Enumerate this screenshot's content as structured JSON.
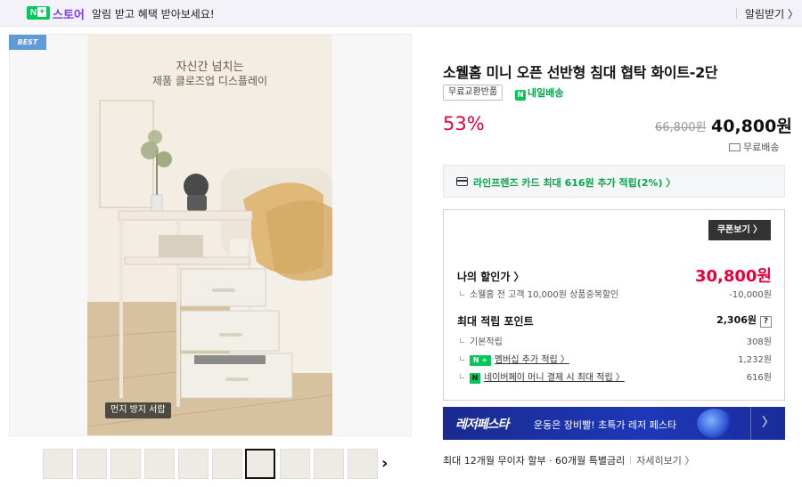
{
  "banner": {
    "nplus_icon": "nplus-logo",
    "store": "스토어",
    "message": "알림 받고 혜택 받아보세요!",
    "notify_label": "알림받기 〉"
  },
  "gallery": {
    "best_badge": "BEST",
    "caption_line1": "자신간 넘치는",
    "caption_line2": "제품 클로즈업 디스플레이",
    "dust_tag": "먼지 방지 서랍",
    "thumbnail_count": 10,
    "active_thumbnail_index": 6,
    "next_icon": "chevron-right-icon"
  },
  "product": {
    "title": "소웰홈 미니 오픈 선반형 침대 협탁 화이트-2단",
    "tag_return": "무료교환반품",
    "tag_delivery": "내일배송",
    "discount": "53%",
    "original_price": "66,800원",
    "price": "40,800원",
    "shipping": "무료배송"
  },
  "card_benefit": {
    "text": "라인프렌즈 카드 최대 616원 추가 적립(2%) 〉"
  },
  "benefit_box": {
    "coupon_button": "쿠폰보기 〉",
    "my_discount_label": "나의 할인가 〉",
    "my_discount_value": "30,800원",
    "coupon_detail": "소웰홈 전 고객 10,000원 상품중복할인",
    "coupon_detail_value": "-10,000원",
    "points_label": "최대 적립 포인트",
    "points_value": "2,306원",
    "help_icon": "?",
    "base_label": "기본적립",
    "base_value": "308원",
    "membership_label": "멤버십 추가 적립 〉",
    "membership_value": "1,232원",
    "npay_label": "네이버페이 머니 결제 시 최대 적립 〉",
    "npay_value": "616원"
  },
  "ad": {
    "brand": "레저페스타",
    "text": "운동은 장비빨! 초특가 레저 페스타",
    "arrow": "〉"
  },
  "installment": {
    "text": "최대 12개월 무이자 할부 · 60개월 특별금리",
    "detail": "자세히보기 〉"
  },
  "colors": {
    "naver_green": "#03c75a",
    "store_purple": "#7b3fe4",
    "discount_red": "#e4003b",
    "ad_blue": "#1d38b8"
  }
}
